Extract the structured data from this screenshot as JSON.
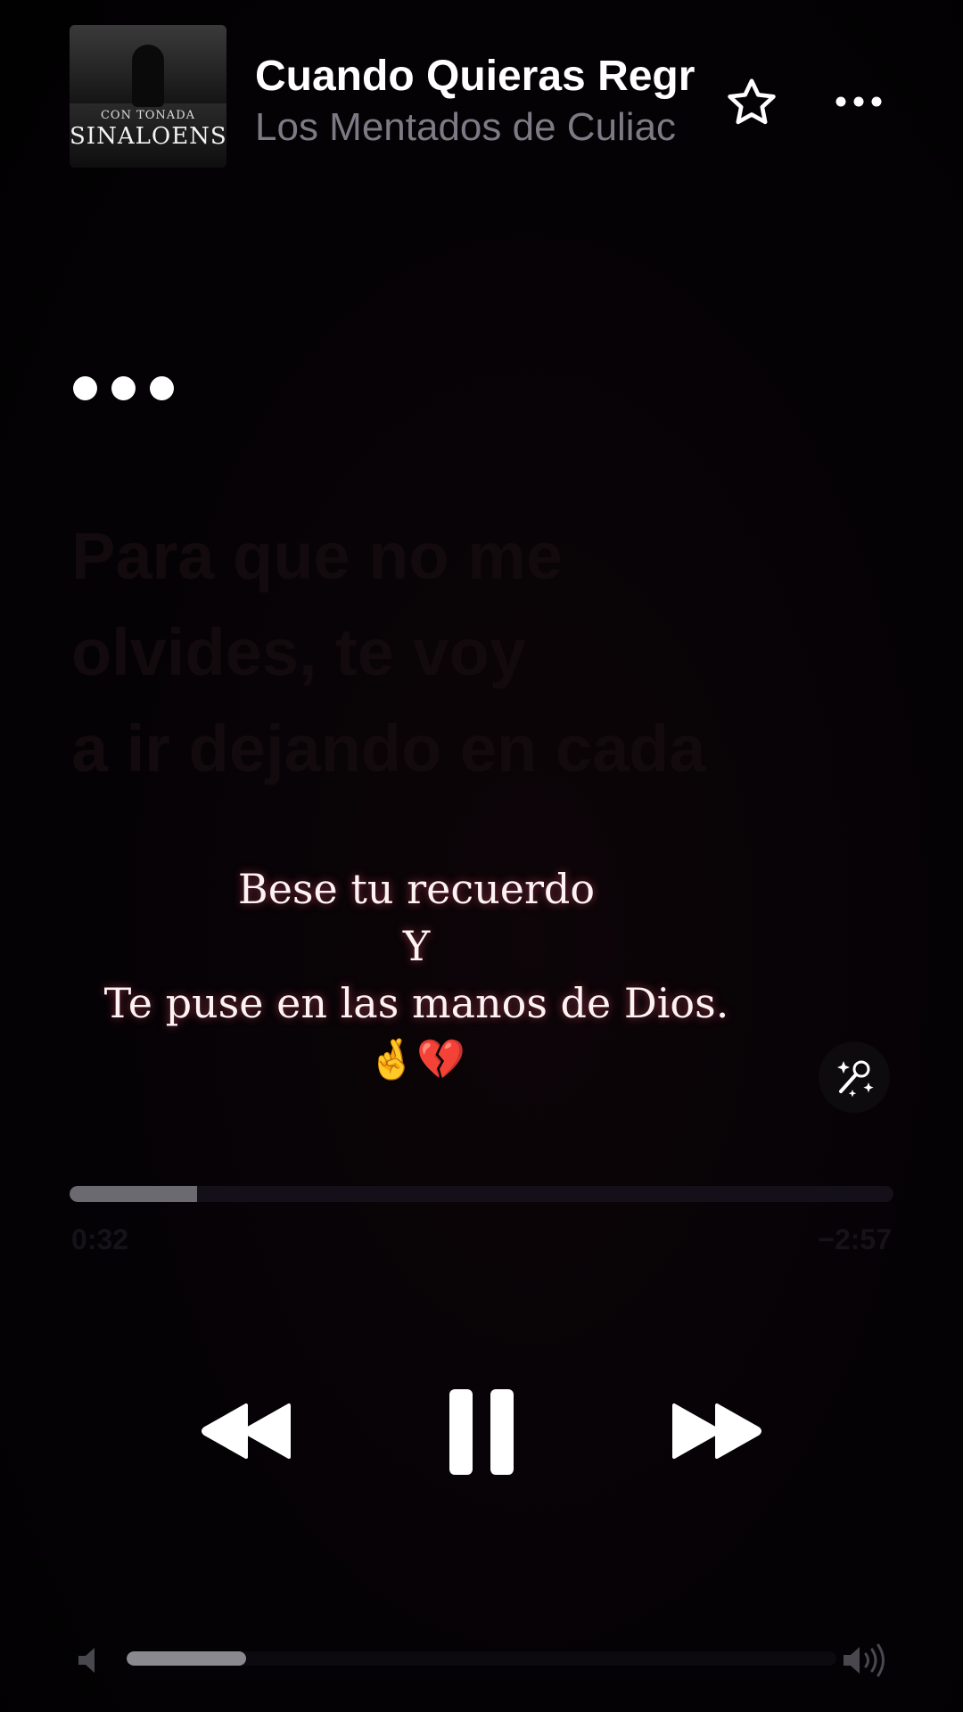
{
  "now_playing": {
    "title": "Cuando Quieras Regr",
    "artist": "Los Mentados de Culiac",
    "artwork": {
      "line1": "CON TONADA",
      "line2": "SINALOENSE"
    }
  },
  "lyrics": {
    "faded_lines": [
      "Para que no me",
      "olvides, te voy",
      "a ir dejando en cada"
    ],
    "caption_lines": [
      "Bese tu recuerdo",
      "Y",
      "Te puse en las manos de Dios."
    ],
    "caption_emoji": "🤞💔"
  },
  "playback": {
    "elapsed": "0:32",
    "remaining": "−2:57",
    "progress_fraction": 0.155
  },
  "volume": {
    "level_fraction": 0.168
  },
  "icons": {
    "favorite": "star-icon",
    "more": "ellipsis-icon",
    "lyrics_mic": "sparkle-microphone-icon",
    "rewind": "rewind-icon",
    "pause": "pause-icon",
    "forward": "fast-forward-icon",
    "volume_low": "speaker-low-icon",
    "volume_high": "speaker-high-icon"
  },
  "colors": {
    "background": "#040204",
    "title": "#ffffff",
    "artist": "#7c7a84",
    "progress_fill": "#6b6a71",
    "caption_glow": "#ff5a78"
  }
}
